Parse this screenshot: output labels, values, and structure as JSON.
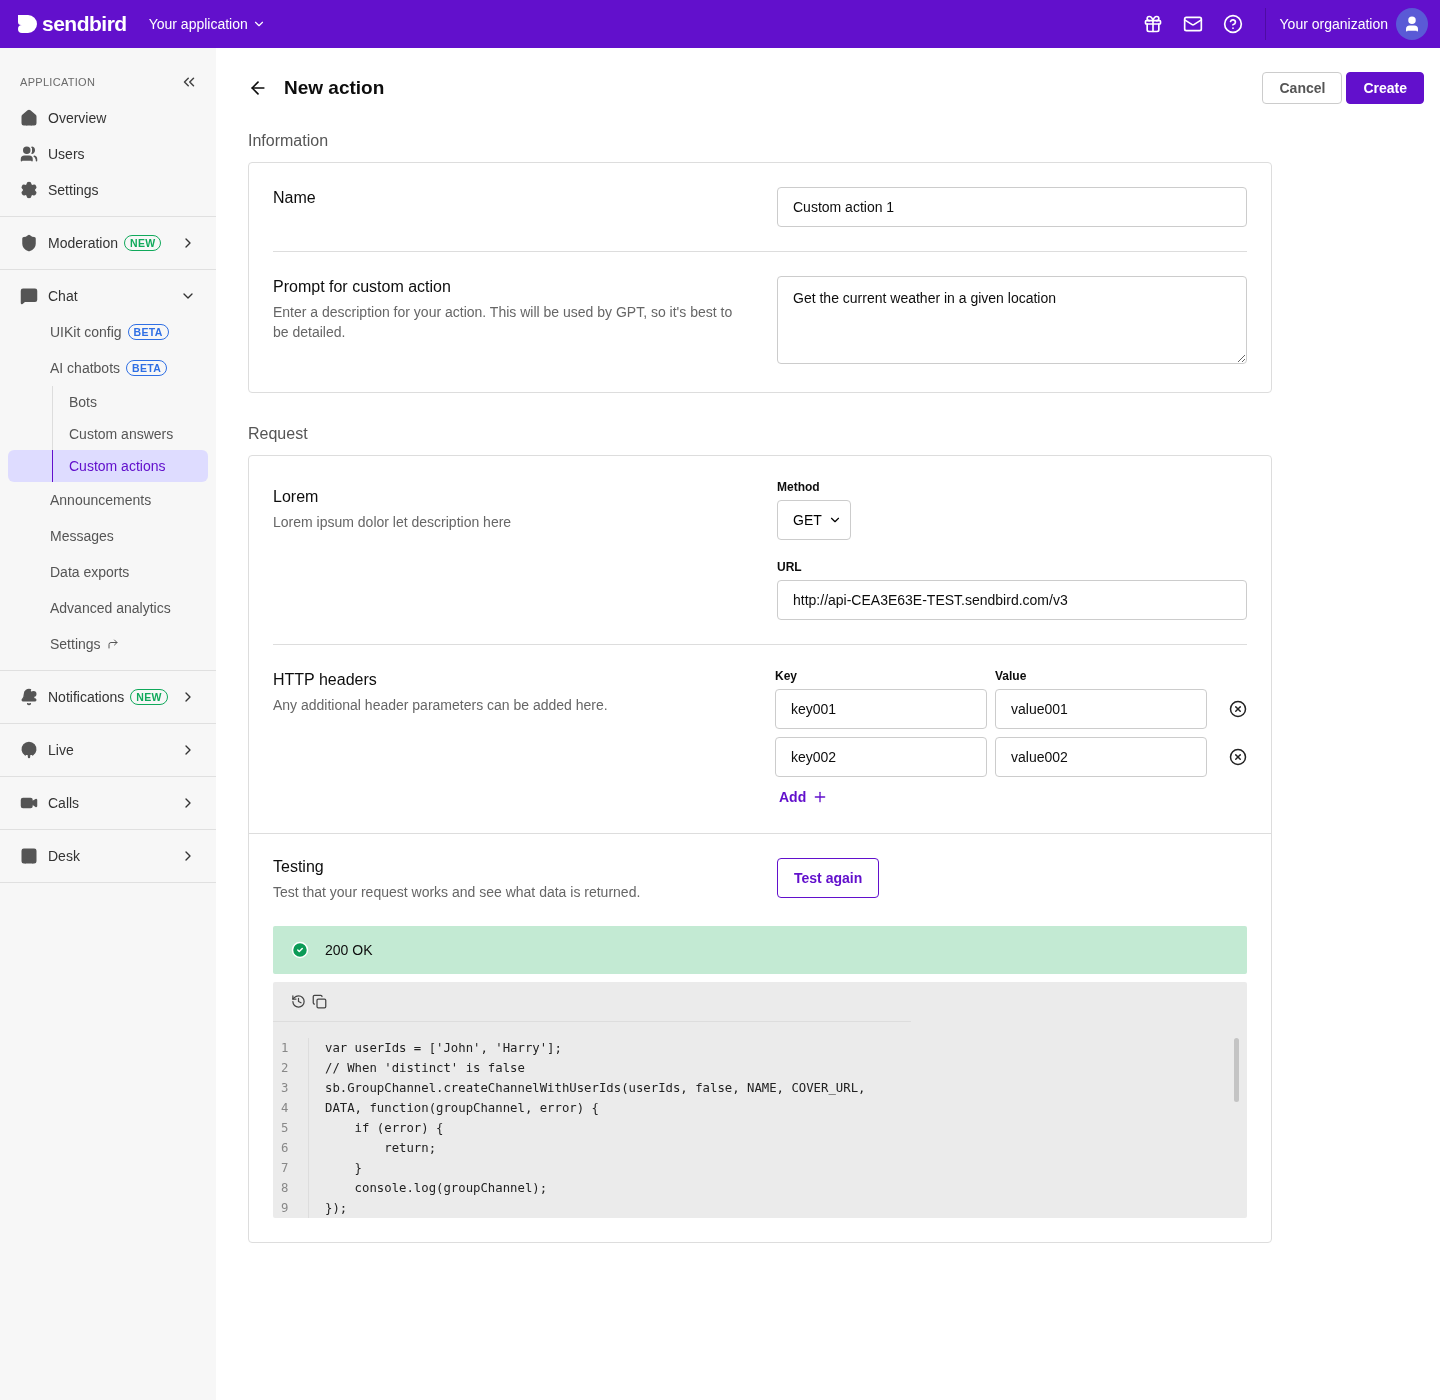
{
  "topbar": {
    "logo": "sendbird",
    "app": "Your application",
    "org": "Your organization"
  },
  "sidebar": {
    "heading": "APPLICATION",
    "groups": [
      {
        "items": [
          {
            "label": "Overview",
            "selected": false
          },
          {
            "label": "Users",
            "selected": false
          },
          {
            "label": "Settings",
            "selected": false
          }
        ]
      },
      {
        "items": [
          {
            "label": "Moderation",
            "selected": false,
            "expanded": false,
            "badge": {
              "text": "NEW",
              "color": "#10a95b"
            }
          }
        ]
      },
      {
        "items": [
          {
            "label": "Chat",
            "selected": false,
            "expanded": true,
            "children": [
              {
                "label": "UIKit config",
                "selected": false,
                "badge": {
                  "text": "BETA",
                  "color": "#2f6fe4"
                }
              },
              {
                "label": "AI chatbots",
                "selected": false,
                "badge": {
                  "text": "BETA",
                  "color": "#2f6fe4"
                },
                "children": [
                  {
                    "label": "Bots",
                    "selected": false
                  },
                  {
                    "label": "Custom answers",
                    "selected": false
                  },
                  {
                    "label": "Custom actions",
                    "selected": true
                  }
                ]
              },
              {
                "label": "Announcements",
                "selected": false
              },
              {
                "label": "Messages",
                "selected": false
              },
              {
                "label": "Data exports",
                "selected": false
              },
              {
                "label": "Advanced analytics",
                "selected": false
              },
              {
                "label": "Settings",
                "selected": false,
                "external": true
              }
            ]
          }
        ]
      },
      {
        "items": [
          {
            "label": "Notifications",
            "selected": false,
            "expanded": false,
            "badge": {
              "text": "NEW",
              "color": "#10a95b"
            }
          }
        ]
      },
      {
        "items": [
          {
            "label": "Live",
            "selected": false,
            "expanded": false
          }
        ]
      },
      {
        "items": [
          {
            "label": "Calls",
            "selected": false,
            "expanded": false
          }
        ]
      },
      {
        "items": [
          {
            "label": "Desk",
            "selected": false,
            "expanded": false
          }
        ]
      }
    ]
  },
  "page": {
    "title": "New action",
    "buttons": [
      {
        "label": "Cancel",
        "kind": "secondary"
      },
      {
        "label": "Create",
        "kind": "primary"
      }
    ]
  },
  "information": {
    "heading": "Information",
    "rows": [
      {
        "label": "Name",
        "value": "Custom action 1",
        "kind": "input"
      },
      {
        "label": "Prompt for custom action",
        "description": "Enter a description for your action. This will be used by GPT, so it's best to be detailed.",
        "value": "Get the current weather in a given location",
        "kind": "textarea"
      }
    ]
  },
  "request": {
    "heading": "Request",
    "endpoint": {
      "label": "Lorem",
      "description": "Lorem ipsum dolor let description here",
      "method_label": "Method",
      "method": "GET",
      "url_label": "URL",
      "url": "http://api-CEA3E63E-TEST.sendbird.com/v3"
    },
    "headers": {
      "label": "HTTP headers",
      "description": "Any additional header parameters can be added here.",
      "key_label": "Key",
      "value_label": "Value",
      "rows": [
        {
          "key": "key001",
          "value": "value001"
        },
        {
          "key": "key002",
          "value": "value002"
        }
      ],
      "add": "Add"
    },
    "testing": {
      "label": "Testing",
      "description": "Test that your request works and see what data is returned.",
      "button": "Test again",
      "status": "200 OK",
      "code": [
        {
          "number": "1",
          "text": "var userIds = ['John', 'Harry'];"
        },
        {
          "number": "2",
          "text": "// When 'distinct' is false"
        },
        {
          "number": "3",
          "text": "sb.GroupChannel.createChannelWithUserIds(userIds, false, NAME, COVER_URL,"
        },
        {
          "number": "4",
          "text": "DATA, function(groupChannel, error) {"
        },
        {
          "number": "5",
          "text": "    if (error) {"
        },
        {
          "number": "6",
          "text": "        return;"
        },
        {
          "number": "7",
          "text": "    }"
        },
        {
          "number": "8",
          "text": "    console.log(groupChannel);"
        },
        {
          "number": "9",
          "text": "});"
        }
      ]
    }
  }
}
